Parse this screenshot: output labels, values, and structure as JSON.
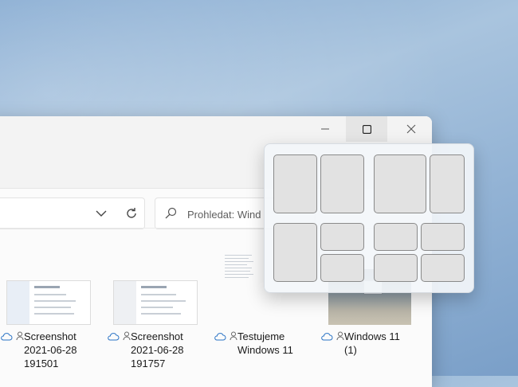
{
  "window": {
    "caption": {
      "minimize_glyph": "—",
      "maximize_glyph": "☐",
      "close_glyph": "✕"
    },
    "address": {
      "dropdown_icon": "chevron-down-icon",
      "refresh_icon": "refresh-icon"
    },
    "search": {
      "icon": "search-icon",
      "placeholder": "Prohledat: Wind"
    }
  },
  "files": [
    {
      "line1": "Screenshot",
      "line2": "2021-06-28",
      "line3": "191501",
      "icons": [
        "cloud-icon",
        "person-icon"
      ]
    },
    {
      "line1": "Screenshot",
      "line2": "2021-06-28",
      "line3": "191757",
      "icons": [
        "cloud-icon",
        "person-icon"
      ]
    },
    {
      "line1": "Testujeme",
      "line2": "Windows 11",
      "line3": "",
      "icons": [
        "cloud-icon",
        "person-icon"
      ]
    },
    {
      "line1": "Windows 11",
      "line2": "(1)",
      "line3": "",
      "icons": [
        "cloud-icon",
        "person-icon"
      ]
    }
  ],
  "snap_layouts": [
    {
      "name": "two-equal-columns",
      "zones": 2
    },
    {
      "name": "two-columns-wide-left",
      "zones": 2
    },
    {
      "name": "left-column-right-stacked",
      "zones": 3
    },
    {
      "name": "four-grid",
      "zones": 4
    }
  ],
  "colors": {
    "desktop": "#8fb0d3",
    "window_bg": "#fbfbfb",
    "titlebar": "#f3f3f3",
    "zone_fill": "#e2e2e2",
    "zone_border": "#8a8a8a"
  }
}
